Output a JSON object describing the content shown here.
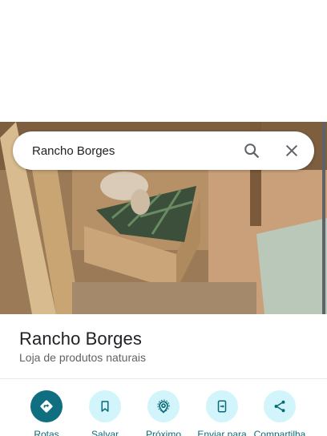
{
  "search": {
    "query": "Rancho Borges",
    "search_icon": "search-icon",
    "close_icon": "close-icon"
  },
  "photo": {
    "description_icon": "place-photo"
  },
  "place": {
    "name": "Rancho Borges",
    "category": "Loja de produtos naturais"
  },
  "actions": [
    {
      "label": "Rotas",
      "icon": "directions-icon",
      "primary": true
    },
    {
      "label": "Salvar",
      "icon": "bookmark-icon",
      "primary": false
    },
    {
      "label": "Próximo",
      "icon": "nearby-icon",
      "primary": false
    },
    {
      "label": "Enviar para",
      "icon": "send-to-phone-icon",
      "primary": false
    },
    {
      "label": "Compartilha",
      "icon": "share-icon",
      "primary": false
    }
  ],
  "colors": {
    "accent": "#0b6a77",
    "primary_button": "#0f6f80",
    "secondary_button": "#d2f4fb"
  }
}
